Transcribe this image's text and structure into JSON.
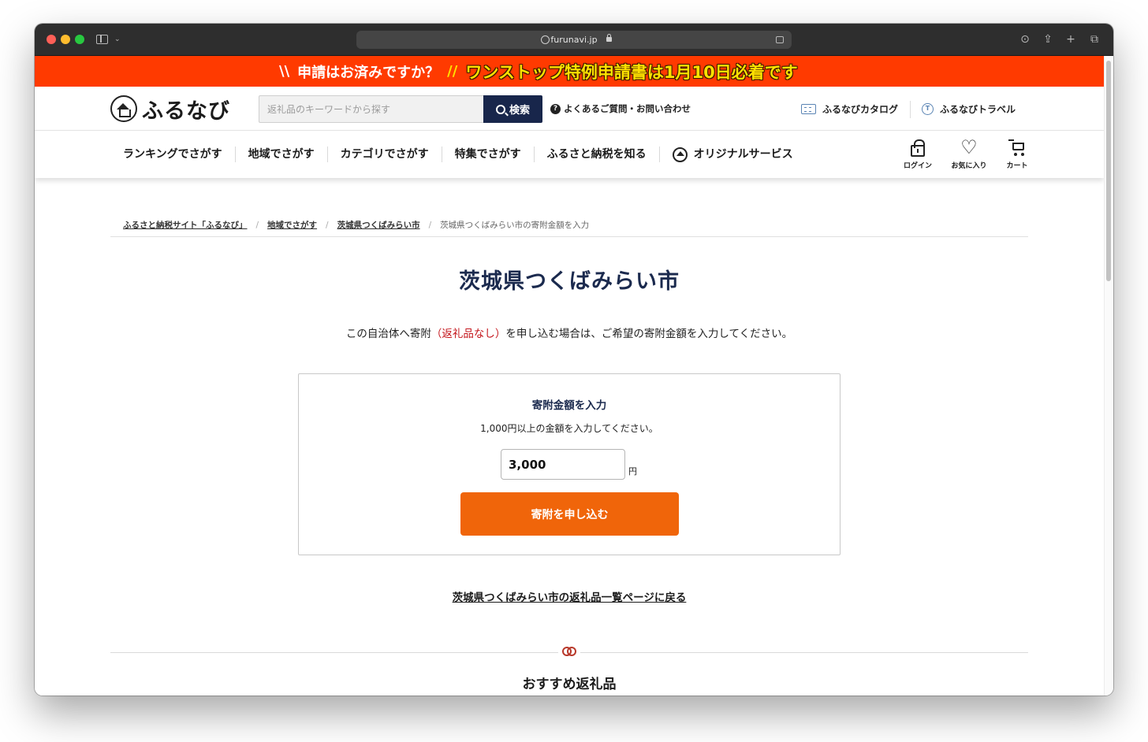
{
  "browser": {
    "url": "furunavi.jp"
  },
  "promo": {
    "question": "申請はお済みですか？",
    "deco_left": "\\\\",
    "deco_right": "//",
    "main": "ワンストップ特例申請書は1月10日必着です"
  },
  "header": {
    "logo_text": "ふるなび",
    "search_placeholder": "返礼品のキーワードから探す",
    "search_button": "検索",
    "faq": "よくあるご質問・お問い合わせ",
    "catalog": "ふるなびカタログ",
    "travel": "ふるなびトラベル"
  },
  "nav": {
    "items": [
      "ランキングでさがす",
      "地域でさがす",
      "カテゴリでさがす",
      "特集でさがす",
      "ふるさと納税を知る",
      "オリジナルサービス"
    ],
    "login": "ログイン",
    "favorites": "お気に入り",
    "cart": "カート"
  },
  "breadcrumb": {
    "items": [
      "ふるさと納税サイト「ふるなび」",
      "地域でさがす",
      "茨城県つくばみらい市"
    ],
    "current": "茨城県つくばみらい市の寄附金額を入力"
  },
  "main": {
    "title": "茨城県つくばみらい市",
    "lead_before": "この自治体へ寄附",
    "lead_highlight": "（返礼品なし）",
    "lead_after": "を申し込む場合は、ご希望の寄附金額を入力してください。",
    "accent_color": "#c4161c"
  },
  "form": {
    "title": "寄附金額を入力",
    "note": "1,000円以上の金額を入力してください。",
    "amount": "3,000",
    "unit": "円",
    "submit": "寄附を申し込む",
    "button_color": "#f0650a"
  },
  "back_link": "茨城県つくばみらい市の返礼品一覧ページに戻る",
  "recommend": {
    "title": "おすすめ返礼品"
  }
}
